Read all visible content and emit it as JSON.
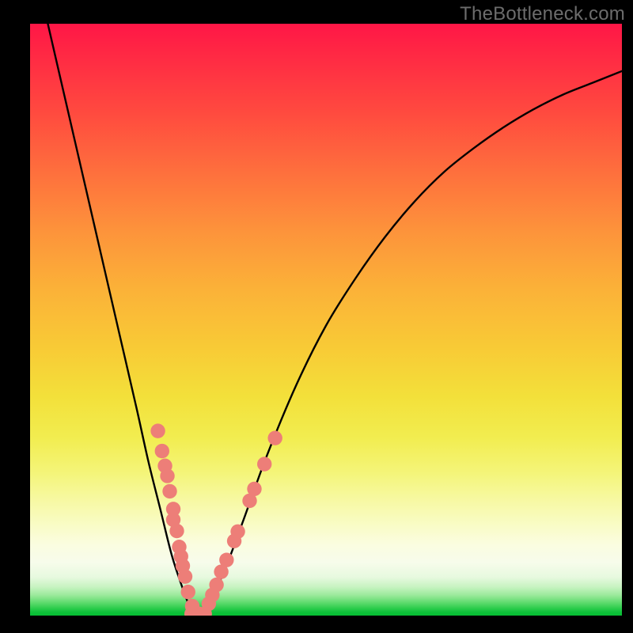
{
  "watermark": "TheBottleneck.com",
  "chart_data": {
    "type": "line",
    "title": "",
    "xlabel": "",
    "ylabel": "",
    "xlim": [
      0,
      100
    ],
    "ylim": [
      0,
      100
    ],
    "series": [
      {
        "name": "bottleneck-curve",
        "x": [
          3,
          6,
          9,
          12,
          15,
          18,
          20,
          22,
          24,
          26,
          27,
          28,
          29,
          30,
          33,
          36,
          40,
          45,
          50,
          55,
          60,
          65,
          70,
          75,
          80,
          85,
          90,
          95,
          100
        ],
        "y": [
          100,
          87,
          74,
          61,
          48,
          35,
          26,
          18,
          10,
          4,
          1.5,
          0.3,
          0.3,
          1.5,
          8,
          16,
          27,
          39,
          49,
          57,
          64,
          70,
          75,
          79,
          82.5,
          85.5,
          88,
          90,
          92
        ]
      }
    ],
    "markers": {
      "name": "sample-dots",
      "color": "#ed7e78",
      "points": [
        {
          "x": 21.6,
          "y": 31.2
        },
        {
          "x": 22.3,
          "y": 27.8
        },
        {
          "x": 22.8,
          "y": 25.3
        },
        {
          "x": 23.2,
          "y": 23.6
        },
        {
          "x": 23.6,
          "y": 21.0
        },
        {
          "x": 24.2,
          "y": 18.0
        },
        {
          "x": 24.2,
          "y": 16.2
        },
        {
          "x": 24.8,
          "y": 14.3
        },
        {
          "x": 25.2,
          "y": 11.6
        },
        {
          "x": 25.5,
          "y": 10.0
        },
        {
          "x": 25.8,
          "y": 8.4
        },
        {
          "x": 26.2,
          "y": 6.6
        },
        {
          "x": 26.7,
          "y": 4.0
        },
        {
          "x": 27.4,
          "y": 1.6
        },
        {
          "x": 27.3,
          "y": 0.3
        },
        {
          "x": 28.5,
          "y": 0.3
        },
        {
          "x": 29.5,
          "y": 0.3
        },
        {
          "x": 30.2,
          "y": 2.0
        },
        {
          "x": 30.8,
          "y": 3.5
        },
        {
          "x": 31.5,
          "y": 5.2
        },
        {
          "x": 32.3,
          "y": 7.4
        },
        {
          "x": 33.2,
          "y": 9.4
        },
        {
          "x": 34.5,
          "y": 12.6
        },
        {
          "x": 35.1,
          "y": 14.2
        },
        {
          "x": 37.1,
          "y": 19.4
        },
        {
          "x": 37.9,
          "y": 21.4
        },
        {
          "x": 39.6,
          "y": 25.6
        },
        {
          "x": 41.4,
          "y": 30.0
        }
      ]
    }
  }
}
